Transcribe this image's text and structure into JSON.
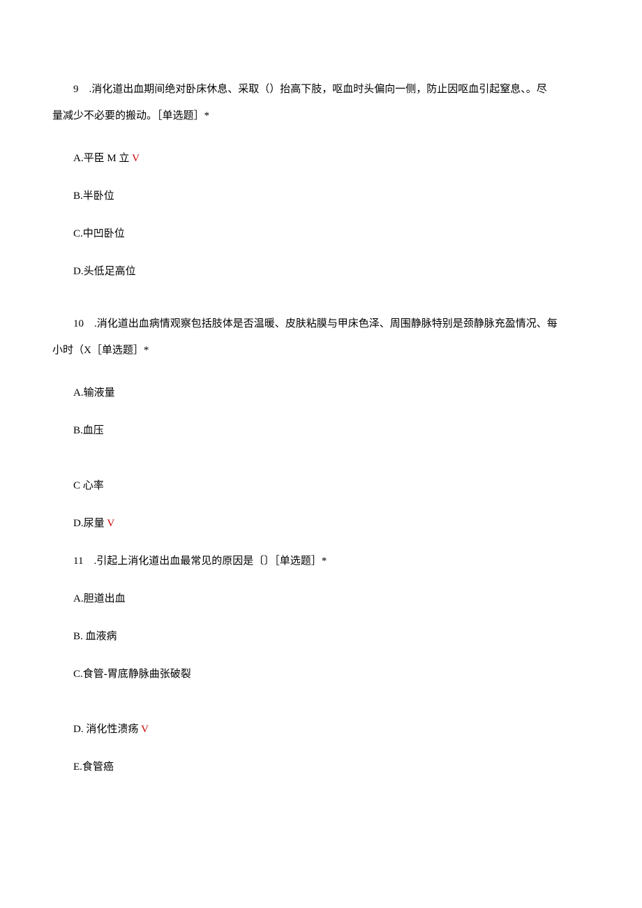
{
  "q9": {
    "line1": "9　.消化道出血期间绝对卧床休息、采取（）抬高下肢，呕血时头偏向一侧，防止因呕血引起窒息、。尽",
    "line2": "量减少不必要的搬动。［单选题］*",
    "optA_text": "A.平臣 M 立 ",
    "optA_mark": "V",
    "optB": "B.半卧位",
    "optC": "C.中凹卧位",
    "optD": "D.头低足高位"
  },
  "q10": {
    "line1": "10　.消化道出血病情观察包括肢体是否温暖、皮肤粘膜与甲床色泽、周围静脉特别是颈静脉充盈情况、每",
    "line2": "小时（X［单选题］*",
    "optA": "A.输液量",
    "optB": "B.血压",
    "optC": "C 心率",
    "optD_text": "D.尿量 ",
    "optD_mark": "V"
  },
  "q11": {
    "text": "11　.引起上消化道出血最常见的原因是〔〕［单选题］*",
    "optA": "A.胆道出血",
    "optB": "B. 血液病",
    "optC": "C.食管-胃底静脉曲张破裂",
    "optD_text": "D. 消化性溃疡 ",
    "optD_mark": "V",
    "optE": "E.食管癌"
  }
}
